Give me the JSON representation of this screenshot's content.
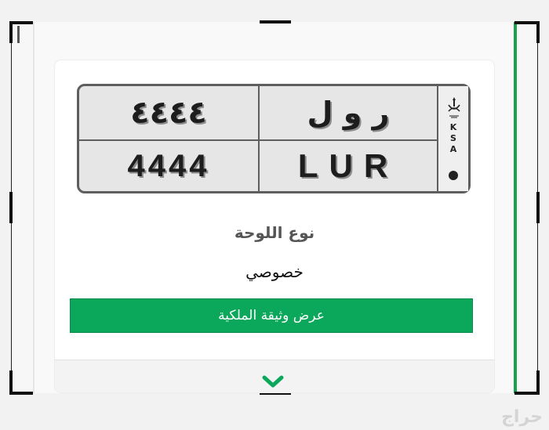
{
  "plate": {
    "arabic_digits": "٤٤٤٤",
    "arabic_letters": "ر و ل",
    "latin_digits": "4444",
    "latin_letters": "LUR",
    "country_code": [
      "K",
      "S",
      "A"
    ]
  },
  "plate_type": {
    "title": "نوع اللوحة",
    "value": "خصوصي"
  },
  "actions": {
    "view_ownership_label": "عرض وثيقة الملكية"
  },
  "watermark": {
    "text": "حراج"
  },
  "colors": {
    "accent": "#0ba75b",
    "side_bar": "#18a24e",
    "plate_border": "#5e5e5e"
  },
  "icons": {
    "emblem": "saudi-emblem-icon",
    "expand": "chevron-down-icon"
  }
}
